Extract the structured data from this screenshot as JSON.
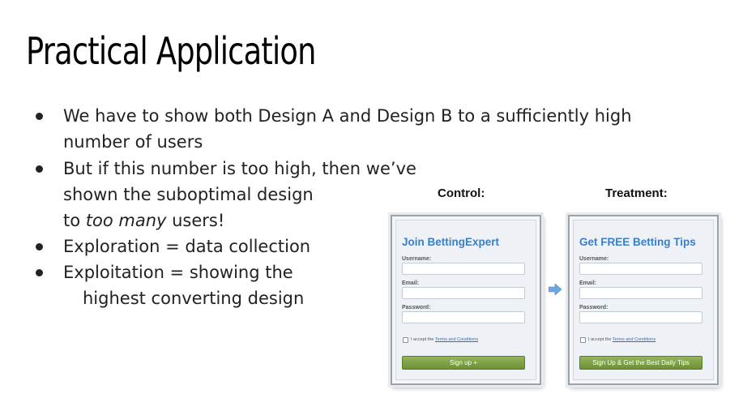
{
  "slide": {
    "title": "Practical Application",
    "bullets": [
      {
        "lines": [
          "We have to show both Design A and Design B to a sufficiently high",
          "number of users"
        ]
      },
      {
        "lines": [
          "But if this number is too high, then we’ve",
          "shown the suboptimal design"
        ],
        "line3_before": "to ",
        "line3_emph": "too many",
        "line3_after": " users!"
      },
      {
        "lines": [
          "Exploration = data collection"
        ]
      },
      {
        "lines": [
          "Exploitation = showing the",
          "highest converting design"
        ]
      }
    ]
  },
  "experiment": {
    "control_label": "Control:",
    "treatment_label": "Treatment:",
    "control_form": {
      "heading": "Join BettingExpert",
      "username_label": "Username:",
      "email_label": "Email:",
      "password_label": "Password:",
      "accept_text": "I accept the ",
      "terms_link": "Terms and Conditions",
      "button_label": "Sign up +"
    },
    "treatment_form": {
      "heading": "Get FREE Betting Tips",
      "username_label": "Username:",
      "email_label": "Email:",
      "password_label": "Password:",
      "accept_text": "I accept the ",
      "terms_link": "Terms and Conditions",
      "button_label": "Sign Up & Get the Best Daily Tips"
    },
    "arrow_icon": "right-arrow-icon",
    "colors": {
      "heading": "#3a7ec6",
      "button": "#7a9c3f",
      "arrow": "#6ea6e0"
    }
  }
}
